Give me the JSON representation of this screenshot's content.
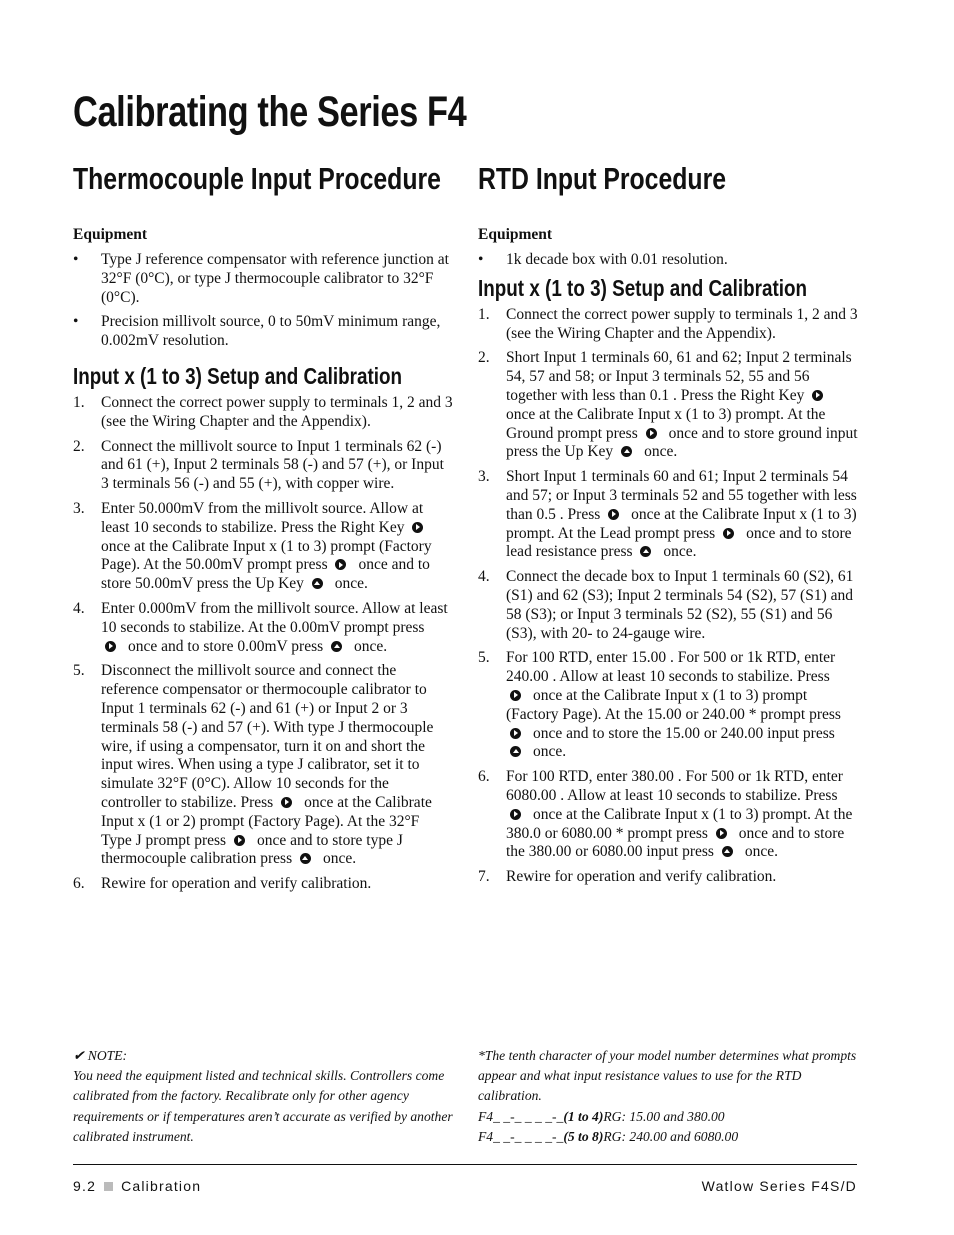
{
  "title": "Calibrating the Series F4",
  "left": {
    "heading": "Thermocouple Input Procedure",
    "equipment_label": "Equipment",
    "equipment": [
      [
        {
          "t": "Type J reference compensator with reference junction at 32°F (0°C), or type J thermocouple calibrator to 32°F (0°C)."
        }
      ],
      [
        {
          "t": "Precision millivolt source, 0 to 50mV minimum range, 0.002mV resolution."
        }
      ]
    ],
    "subheading": "Input x (1 to 3) Setup and Calibration",
    "steps": [
      [
        {
          "t": "Connect the correct power supply to terminals 1, 2 and 3 (see the Wiring Chapter and the Appendix)."
        }
      ],
      [
        {
          "t": "Connect the millivolt source to Input 1 terminals 62 (-) and 61 (+), Input 2 terminals 58 (-) and 57 (+), or Input 3 terminals 56 (-) and 55 (+), with copper wire."
        }
      ],
      [
        {
          "t": "Enter 50.000mV from the millivolt source. Allow at least 10 seconds to stabilize. Press the Right Key"
        },
        {
          "icon": "right"
        },
        {
          "t": "once at the Calibrate Input x (1 to 3) prompt (Factory Page). At the 50.00mV prompt press"
        },
        {
          "icon": "right"
        },
        {
          "t": "once and to store 50.00mV press the Up Key"
        },
        {
          "icon": "up"
        },
        {
          "t": "once."
        }
      ],
      [
        {
          "t": "Enter 0.000mV from the millivolt source. Allow at least 10 seconds to stabilize. At the 0.00mV prompt press"
        },
        {
          "icon": "right"
        },
        {
          "t": "once and to store 0.00mV press"
        },
        {
          "icon": "up"
        },
        {
          "t": "once."
        }
      ],
      [
        {
          "t": "Disconnect the millivolt source and connect the reference compensator or thermocouple calibrator to Input 1 terminals 62 (-) and 61 (+) or Input 2 or 3 terminals 58 (-) and 57 (+). With type J thermocouple wire, if using a compensator, turn it on and short the input wires. When using a type J calibrator, set it to simulate 32°F (0°C). Allow 10 seconds for the controller to stabilize. Press"
        },
        {
          "icon": "right"
        },
        {
          "t": "once at the Calibrate Input x (1 or 2) prompt (Factory Page). At the 32°F Type J prompt press"
        },
        {
          "icon": "right"
        },
        {
          "t": "once and to store type J thermocouple calibration press"
        },
        {
          "icon": "up"
        },
        {
          "t": "once."
        }
      ],
      [
        {
          "t": "Rewire for operation and verify calibration."
        }
      ]
    ],
    "note_label": "✔ NOTE:",
    "note": "You need the equipment listed and technical skills. Controllers come calibrated from the factory. Recalibrate only for other agency requirements or if temperatures aren’t accurate as verified by another calibrated instrument."
  },
  "right": {
    "heading": "RTD Input Procedure",
    "equipment_label": "Equipment",
    "equipment": [
      [
        {
          "t": "1k    decade box with 0.01    resolution."
        }
      ]
    ],
    "subheading": "Input x (1 to 3) Setup and Calibration",
    "steps": [
      [
        {
          "t": "Connect the correct power supply to terminals 1, 2 and 3 (see the Wiring Chapter and the Appendix)."
        }
      ],
      [
        {
          "t": "Short Input 1 terminals 60, 61 and 62; Input 2 terminals 54, 57 and 58; or Input 3 terminals 52, 55 and 56 together with less than 0.1    . Press the Right Key"
        },
        {
          "icon": "right"
        },
        {
          "t": "once at the Calibrate Input x (1 to 3) prompt. At the Ground prompt press"
        },
        {
          "icon": "right"
        },
        {
          "t": "once and to store ground input press the Up Key"
        },
        {
          "icon": "up"
        },
        {
          "t": "once."
        }
      ],
      [
        {
          "t": "Short Input 1 terminals 60 and 61; Input 2 terminals 54 and 57; or Input 3 terminals 52 and 55 together with less than 0.5    . Press"
        },
        {
          "icon": "right"
        },
        {
          "t": "once at the Calibrate Input x (1 to 3) prompt. At the Lead prompt press"
        },
        {
          "icon": "right"
        },
        {
          "t": "once and to store lead resistance press"
        },
        {
          "icon": "up"
        },
        {
          "t": "once."
        }
      ],
      [
        {
          "t": "Connect the decade box to Input 1 terminals 60 (S2), 61 (S1) and 62 (S3); Input 2 terminals 54 (S2), 57 (S1) and 58 (S3); or Input 3 terminals 52 (S2), 55 (S1) and 56 (S3), with 20- to 24-gauge wire."
        }
      ],
      [
        {
          "t": "For 100    RTD, enter 15.00   . For 500    or 1k RTD, enter 240.00   . Allow at least 10 seconds to stabilize. Press"
        },
        {
          "icon": "right"
        },
        {
          "t": "once at the Calibrate Input x (1 to 3) prompt (Factory Page). At the 15.00    or 240.00   * prompt press"
        },
        {
          "icon": "right"
        },
        {
          "t": "once and to store the 15.00    or 240.00    input press"
        },
        {
          "icon": "up"
        },
        {
          "t": "once."
        }
      ],
      [
        {
          "t": "For 100    RTD, enter 380.00   . For 500    or 1k RTD, enter 6080.00   . Allow at least 10 seconds to stabilize. Press"
        },
        {
          "icon": "right"
        },
        {
          "t": "once at the Calibrate Input x (1 to 3) prompt. At the 380.0    or 6080.00   * prompt press"
        },
        {
          "icon": "right"
        },
        {
          "t": "once and to store the 380.00    or 6080.00    input press"
        },
        {
          "icon": "up"
        },
        {
          "t": "once."
        }
      ],
      [
        {
          "t": "Rewire for operation and verify calibration."
        }
      ]
    ],
    "footnote": "*The tenth character of your model number determines what prompts appear and what input resistance values to use for the RTD calibration.",
    "model_lines": [
      {
        "prefix": "F4_ _-_ _ _ _-_",
        "bold": "(1 to 4)",
        "suffix": "RG:  15.00 and 380.00"
      },
      {
        "prefix": "F4_ _-_ _ _ _-_",
        "bold": "(5 to 8)",
        "suffix": "RG:  240.00 and 6080.00"
      }
    ]
  },
  "footer": {
    "page": "9.2",
    "section": "Calibration",
    "product": "Watlow Series F4S/D"
  }
}
